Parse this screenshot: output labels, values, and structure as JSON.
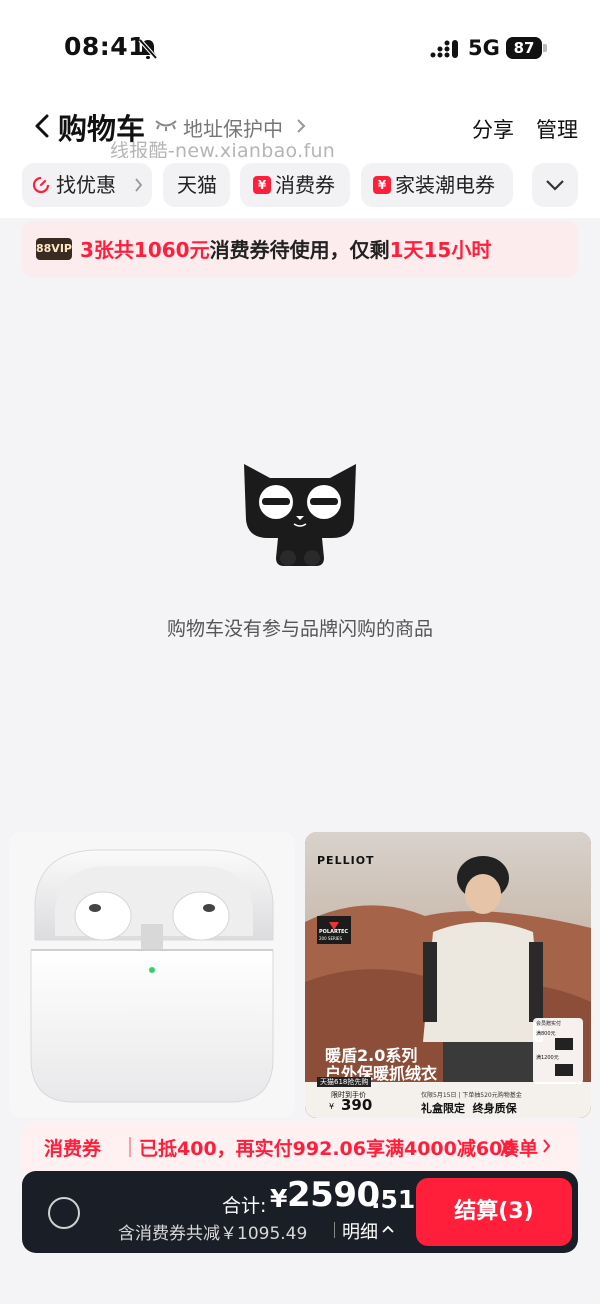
{
  "status_bar": {
    "time": "08:41",
    "network": "5G",
    "battery": "87"
  },
  "header": {
    "title": "购物车",
    "address_status": "地址保护中",
    "share": "分享",
    "manage": "管理",
    "watermark": "线报酷-new.xianbao.fun"
  },
  "chips": [
    {
      "label": "找优惠",
      "icon": "timer-icon"
    },
    {
      "label": "天猫"
    },
    {
      "label": "消费券",
      "icon": "yen-coupon-icon"
    },
    {
      "label": "家装潮电券",
      "icon": "yen-coupon-icon"
    }
  ],
  "chip_badge_symbol": "¥",
  "vip_banner": {
    "badge": "88VIP",
    "count_amount": "3张共1060元",
    "mid_text": "消费券待使用，仅剩",
    "remaining": "1天15小时"
  },
  "empty_state": {
    "message": "购物车没有参与品牌闪购的商品"
  },
  "recommend": {
    "right_card": {
      "brand": "PELLIOT",
      "tag_brand": "POLARTEC",
      "tag_series": "200 SERIES",
      "title_line1": "暖盾2.0系列",
      "title_line2": "户外保暖抓绒衣",
      "promo_small": "天猫618抢先购",
      "price_label": "限时到手价",
      "currency": "¥",
      "price": "390",
      "notice": "仅限5月15日 | 下单抽520元购物基金",
      "guarantee": "礼盒限定  终身质保",
      "gift1": "满800元",
      "gift2": "满1200元",
      "gift_title": "会员赠实付"
    }
  },
  "coupon_bar": {
    "label": "消费券",
    "message": "已抵400，再实付992.06享满4000减600",
    "action": "凑单"
  },
  "checkout": {
    "total_label": "合计:",
    "currency": "¥",
    "total_int": "2590",
    "total_dec": ".51",
    "discount": "含消费券共减￥1095.49",
    "detail": "明细",
    "pay_button": "结算(3)"
  },
  "colors": {
    "accent": "#ff1f3b",
    "checkout_bg": "#1a1e27",
    "vip_banner_bg": "#fdecee"
  }
}
